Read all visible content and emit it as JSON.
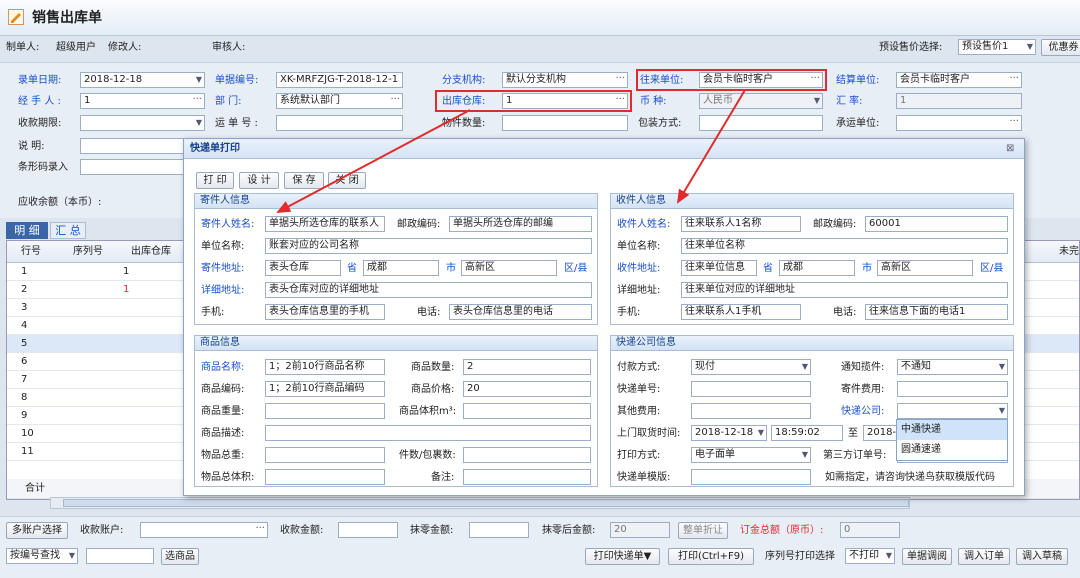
{
  "window": {
    "title": "销售出库单"
  },
  "topbar": {
    "maker_label": "制单人:",
    "maker_value": "超级用户",
    "modifier_label": "修改人:",
    "auditor_label": "审核人:",
    "price_choice_label": "预设售价选择:",
    "price_choice_value": "预设售价1",
    "discount_btn": "优惠券"
  },
  "form": {
    "date_label": "录单日期:",
    "date_value": "2018-12-18",
    "doc_no_label": "单据编号:",
    "doc_no_value": "XK-MRFZJG-T-2018-12-1",
    "branch_label": "分支机构:",
    "branch_value": "默认分支机构",
    "partner_label": "往来单位:",
    "partner_value": "会员卡临时客户",
    "settle_label": "结算单位:",
    "settle_value": "会员卡临时客户",
    "handler_label": "经 手 人 :",
    "handler_value": "1",
    "dept_label": "部    门:",
    "dept_value": "系统默认部门",
    "warehouse_label": "出库仓库:",
    "warehouse_value": "1",
    "currency_label": "币    种:",
    "currency_value": "人民币",
    "rate_label": "汇    率:",
    "rate_value": "1",
    "paydue_label": "收款期限:",
    "waybill_label": "运 单 号 :",
    "parts_label": "物件数量:",
    "pack_label": "包装方式:",
    "carrier_label": "承运单位:",
    "note_label": "说    明:",
    "barcode_label": "条形码录入",
    "receivable_label": "应收余额（本币）:"
  },
  "tabs": [
    "明 细",
    "汇 总"
  ],
  "grid": {
    "headers": [
      "行号",
      "序列号",
      "出库仓库",
      "未完"
    ],
    "rows": [
      "1",
      "2",
      "3",
      "4",
      "5",
      "6",
      "7",
      "8",
      "9",
      "10",
      "11"
    ],
    "row1_wh": "1",
    "row2_wh": "1",
    "total_label": "合计"
  },
  "dialog": {
    "title": "快递单打印",
    "close": "⊠",
    "buttons": [
      "打 印",
      "设 计",
      "保 存",
      "关 闭"
    ],
    "sender": {
      "header": "寄件人信息",
      "name_label": "寄件人姓名:",
      "name_value": "单据头所选仓库的联系人",
      "zip_label": "邮政编码:",
      "zip_value": "单据头所选仓库的邮编",
      "company_label": "单位名称:",
      "company_value": "账套对应的公司名称",
      "addr_label": "寄件地址:",
      "addr_value": "表头仓库",
      "prov_label": "省",
      "prov_value": "成都",
      "city_label": "市",
      "city_value": "高新区",
      "district_label": "区/县",
      "detail_label": "详细地址:",
      "detail_value": "表头仓库对应的详细地址",
      "mobile_label": "手机:",
      "mobile_value": "表头仓库信息里的手机",
      "phone_label": "电话:",
      "phone_value": "表头仓库信息里的电话"
    },
    "receiver": {
      "header": "收件人信息",
      "name_label": "收件人姓名:",
      "name_value": "往来联系人1名称",
      "zip_label": "邮政编码:",
      "zip_value": "60001",
      "company_label": "单位名称:",
      "company_value": "往来单位名称",
      "addr_label": "收件地址:",
      "addr_value": "往来单位信息",
      "prov_label": "省",
      "prov_value": "成都",
      "city_label": "市",
      "city_value": "高新区",
      "district_label": "区/县",
      "detail_label": "详细地址:",
      "detail_value": "往来单位对应的详细地址",
      "mobile_label": "手机:",
      "mobile_value": "往来联系人1手机",
      "phone_label": "电话:",
      "phone_value": "往来信息下面的电话1"
    },
    "goods": {
      "header": "商品信息",
      "name_label": "商品名称:",
      "name_value": "1；2前10行商品名称",
      "qty_label": "商品数量:",
      "qty_value": "2",
      "code_label": "商品编码:",
      "code_value": "1；2前10行商品编码",
      "price_label": "商品价格:",
      "price_value": "20",
      "weight_label": "商品重量:",
      "volume_label": "商品体积m³:",
      "desc_label": "商品描述:",
      "total_weight_label": "物品总重:",
      "pieces_label": "件数/包裹数:",
      "total_volume_label": "物品总体积:",
      "remark_label": "备注:"
    },
    "express": {
      "header": "快递公司信息",
      "pay_label": "付款方式:",
      "pay_value": "现付",
      "notify_label": "通知揽件:",
      "notify_value": "不通知",
      "no_label": "快递单号:",
      "fee_label": "寄件费用:",
      "other_label": "其他费用:",
      "company_label": "快递公司:",
      "pickup_label": "上门取货时间:",
      "pickup_date": "2018-12-18",
      "pickup_time": "18:59:02",
      "to_label": "至",
      "pickup_date2": "2018-1",
      "print_label": "打印方式:",
      "print_value": "电子面单",
      "third_label": "第三方订单号:",
      "tpl_label": "快递单模版:",
      "tpl_hint": "如需指定，请咨询快递鸟获取模版代码",
      "options": [
        "中通快递",
        "圆通速递"
      ]
    }
  },
  "footer": {
    "multi_btn": "多账户选择",
    "account_label": "收款账户:",
    "amount_label": "收款金额:",
    "wipe_label": "抹零金额:",
    "after_wipe_label": "抹零后金额:",
    "after_wipe_value": "20",
    "discount_btn": "整单折让",
    "total_label": "订金总额（原币）:",
    "total_value": "0",
    "search_select": "按编号查找",
    "choose_btn": "选商品",
    "print_express_btn": "打印快递单▼",
    "print_btn": "打印(Ctrl+F9)",
    "serial_label": "序列号打印选择",
    "serial_value": "不打印",
    "adjust_btn": "单据调阅",
    "import_order_btn": "调入订单",
    "import_draft_btn": "调入草稿"
  },
  "colors": {
    "accent_red": "#e02c2c",
    "label_blue": "#1a50c8",
    "panel_header": "#15428b"
  }
}
